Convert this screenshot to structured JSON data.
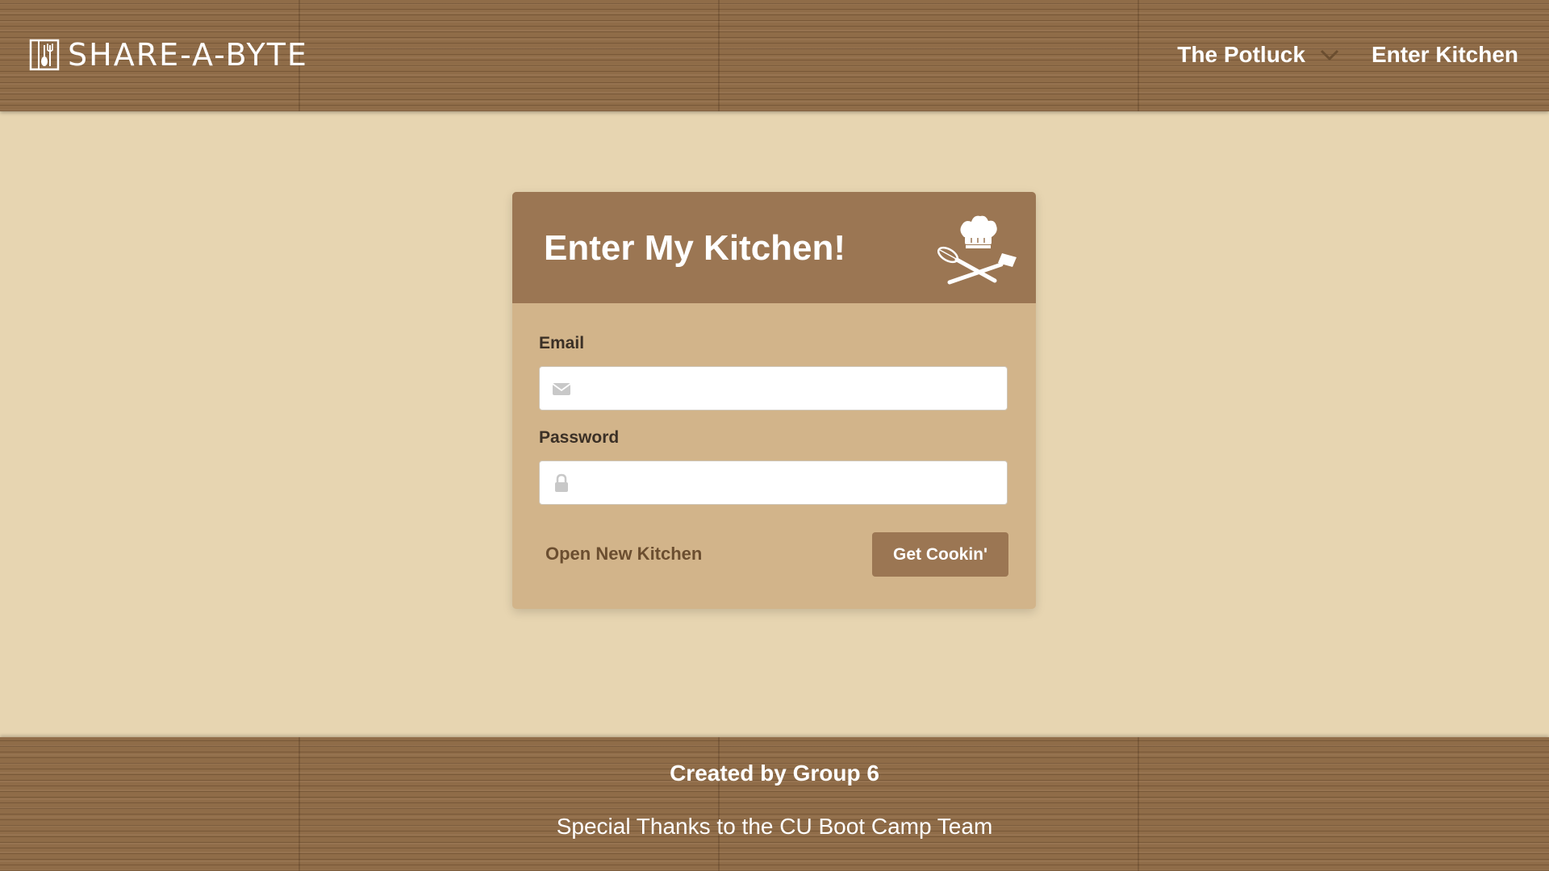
{
  "navbar": {
    "brand": "SHARE-A-BYTE",
    "items": [
      {
        "label": "The Potluck",
        "has_dropdown": true
      },
      {
        "label": "Enter Kitchen",
        "has_dropdown": false
      }
    ]
  },
  "login_card": {
    "title": "Enter My Kitchen!",
    "header_icon": "chef-hat-crossed-utensils-icon",
    "email": {
      "label": "Email",
      "value": "",
      "placeholder": "",
      "icon": "envelope-icon"
    },
    "password": {
      "label": "Password",
      "value": "",
      "placeholder": "",
      "icon": "lock-icon"
    },
    "signup_link": "Open New Kitchen",
    "submit_label": "Get Cookin'"
  },
  "footer": {
    "line1": "Created by Group 6",
    "line2": "Special Thanks to the CU Boot Camp Team"
  },
  "colors": {
    "page_bg": "#e7d5b1",
    "wood": "#8f6c48",
    "card_header": "#9b7653",
    "card_body": "#d2b48a",
    "button": "#9b7653",
    "link": "#6b4e30"
  }
}
